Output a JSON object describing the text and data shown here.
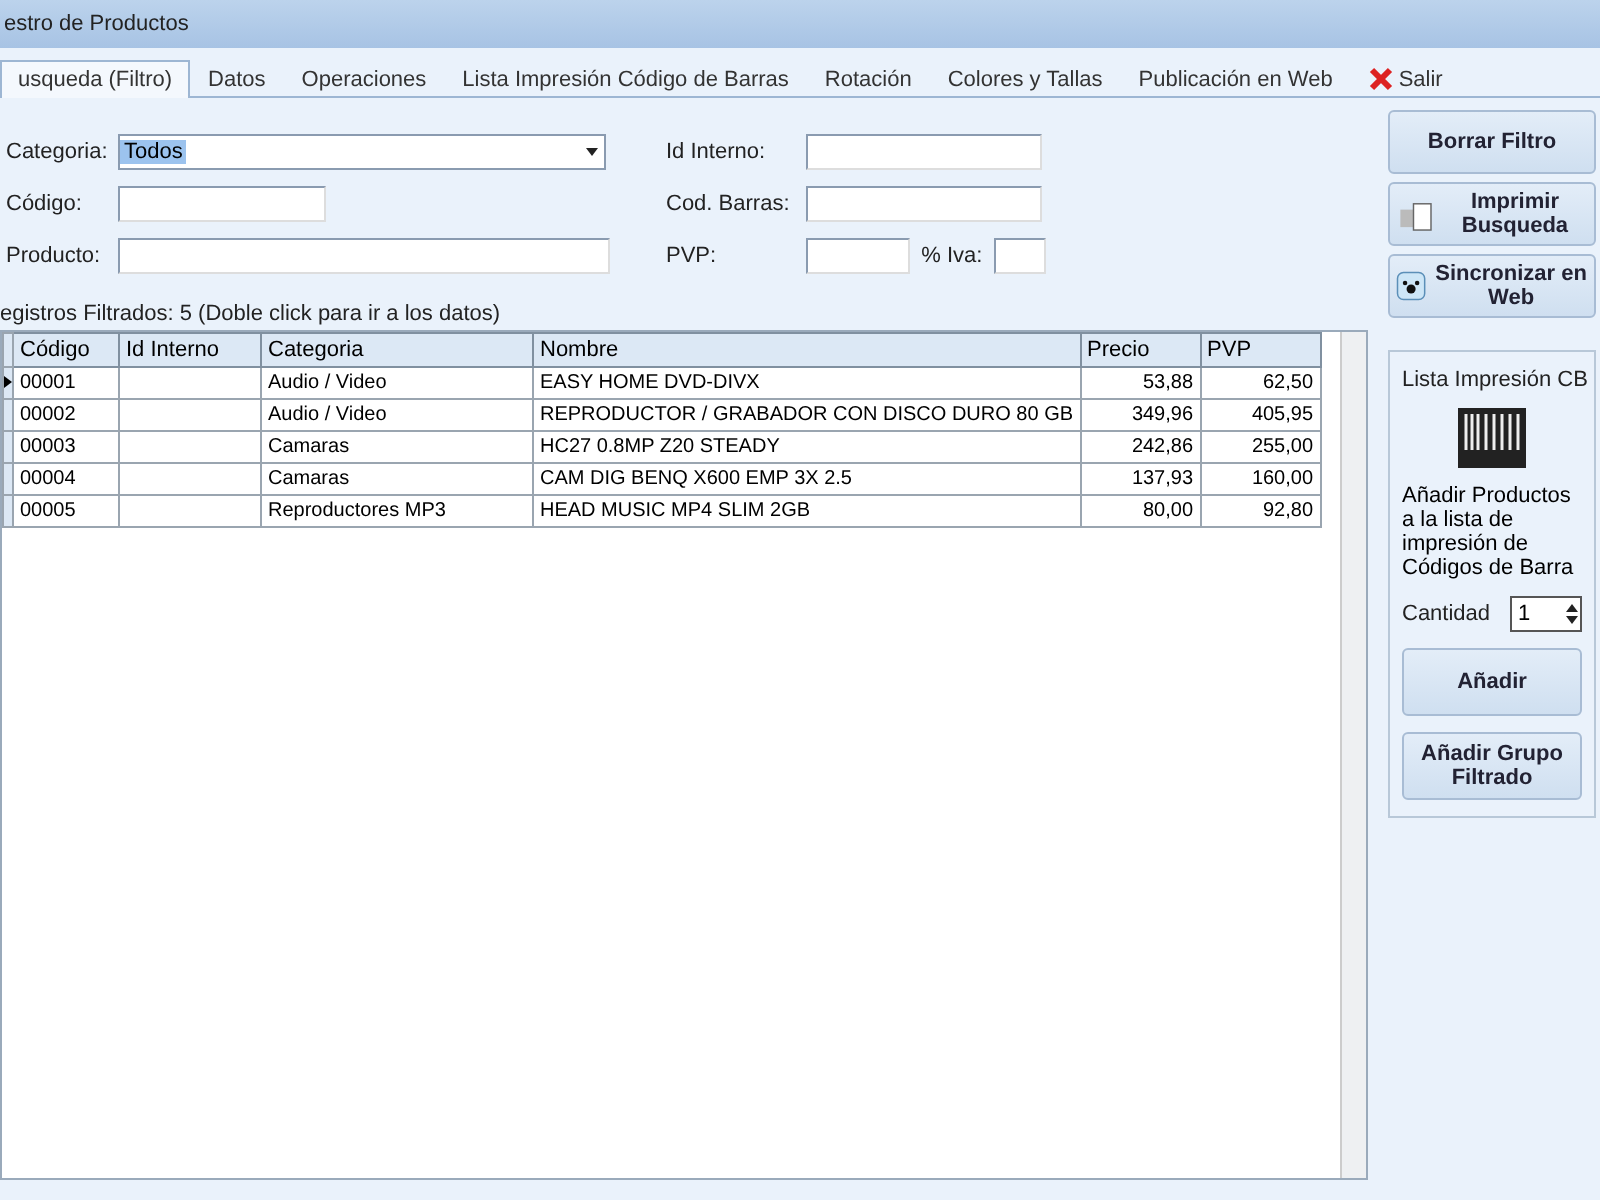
{
  "window": {
    "title": "estro de Productos"
  },
  "tabs": [
    {
      "label": "usqueda (Filtro)",
      "selected": true,
      "kind": "tab"
    },
    {
      "label": "Datos",
      "selected": false,
      "kind": "tab"
    },
    {
      "label": "Operaciones",
      "selected": false,
      "kind": "tab"
    },
    {
      "label": "Lista Impresión Código de Barras",
      "selected": false,
      "kind": "tab"
    },
    {
      "label": "Rotación",
      "selected": false,
      "kind": "tab"
    },
    {
      "label": "Colores y Tallas",
      "selected": false,
      "kind": "tab"
    },
    {
      "label": "Publicación en Web",
      "selected": false,
      "kind": "tab"
    },
    {
      "label": "Salir",
      "selected": false,
      "kind": "exit"
    }
  ],
  "filter": {
    "categoria": {
      "label": "Categoria:",
      "value": "Todos"
    },
    "codigo": {
      "label": "Código:"
    },
    "producto": {
      "label": "Producto:"
    },
    "id_interno": {
      "label": "Id Interno:"
    },
    "cod_barras": {
      "label": "Cod. Barras:"
    },
    "pvp": {
      "label": "PVP:"
    },
    "iva": {
      "label": "% Iva:"
    }
  },
  "result_label": "egistros Filtrados: 5 (Doble click para ir a los datos)",
  "table": {
    "columns": [
      "Código",
      "Id Interno",
      "Categoria",
      "Nombre",
      "Precio",
      "PVP"
    ],
    "rows": [
      {
        "cells": [
          "00001",
          "",
          "Audio / Video",
          "EASY HOME DVD-DIVX",
          "53,88",
          "62,50"
        ],
        "selected": true
      },
      {
        "cells": [
          "00002",
          "",
          "Audio / Video",
          "REPRODUCTOR / GRABADOR CON DISCO DURO 80 GB",
          "349,96",
          "405,95"
        ],
        "selected": false
      },
      {
        "cells": [
          "00003",
          "",
          "Camaras",
          "HC27 0.8MP Z20 STEADY",
          "242,86",
          "255,00"
        ],
        "selected": false
      },
      {
        "cells": [
          "00004",
          "",
          "Camaras",
          "CAM DIG BENQ X600 EMP 3X 2.5",
          "137,93",
          "160,00"
        ],
        "selected": false
      },
      {
        "cells": [
          "00005",
          "",
          "Reproductores MP3",
          "HEAD MUSIC MP4 SLIM 2GB",
          "80,00",
          "92,80"
        ],
        "selected": false
      }
    ]
  },
  "actions": [
    {
      "label": "Borrar Filtro",
      "kind": "plain"
    },
    {
      "label": "Imprimir Busqueda",
      "kind": "printer"
    },
    {
      "label": "Sincronizar en Web",
      "kind": "paw"
    }
  ],
  "barcode_group": {
    "title": "Lista Impresión CB",
    "description": "Añadir Productos a la lista de impresión de Códigos de Barra",
    "quantity_label": "Cantidad",
    "quantity": "1",
    "buttons": [
      "Añadir",
      "Añadir Grupo Filtrado"
    ]
  }
}
